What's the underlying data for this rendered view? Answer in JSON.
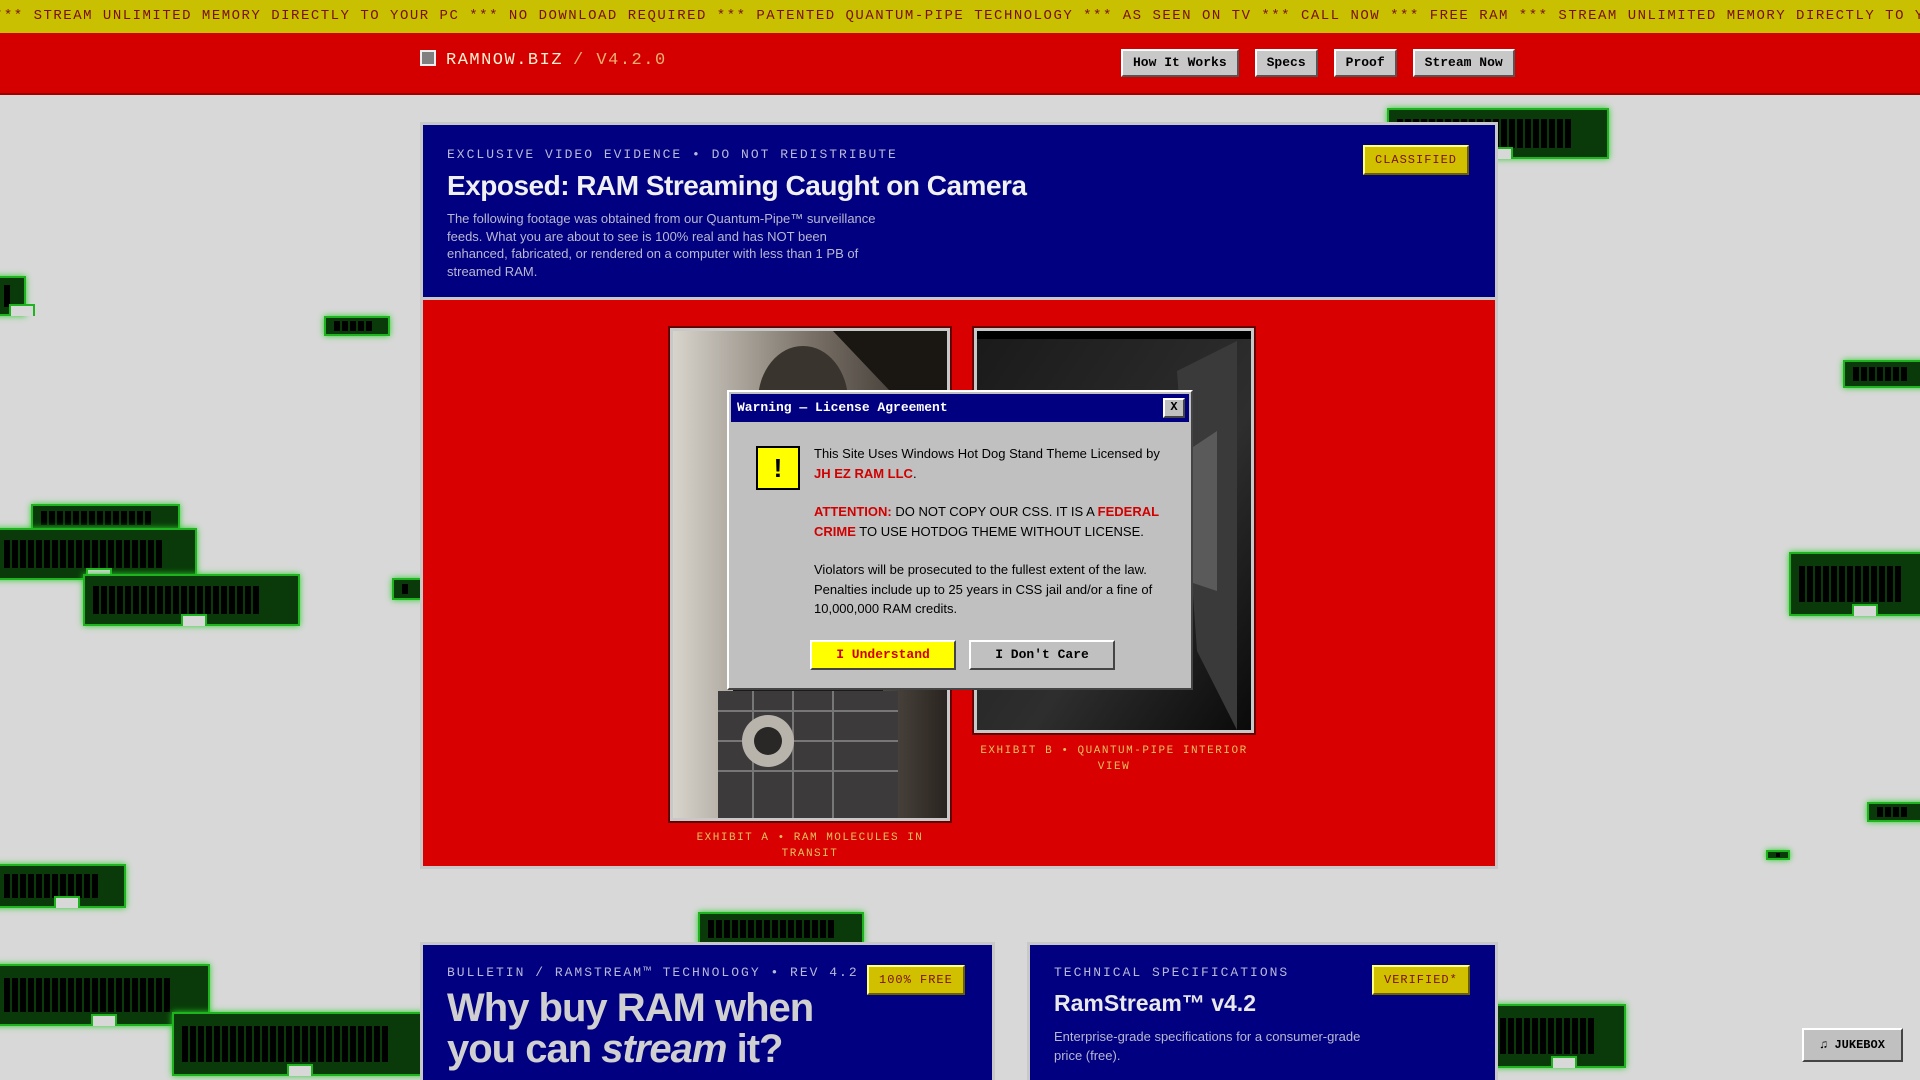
{
  "ticker": {
    "text": "*** STREAM UNLIMITED MEMORY DIRECTLY TO YOUR PC *** NO DOWNLOAD REQUIRED *** PATENTED QUANTUM-PIPE TECHNOLOGY *** AS SEEN ON TV *** CALL NOW *** FREE RAM *** STREAM UNLIMITED MEMORY DIRECTLY TO YOUR PC ***"
  },
  "header": {
    "brand": "RAMNOW.BIZ",
    "version": "/ V4.2.0",
    "nav": [
      "How It Works",
      "Specs",
      "Proof",
      "Stream Now"
    ]
  },
  "evidence": {
    "kicker": "EXCLUSIVE VIDEO EVIDENCE • DO NOT REDISTRIBUTE",
    "title": "Exposed: RAM Streaming Caught on Camera",
    "description": "The following footage was obtained from our Quantum-Pipe™ surveillance feeds. What you are about to see is 100% real and has NOT been enhanced, fabricated, or rendered on a computer with less than 1 PB of streamed RAM.",
    "badge": "CLASSIFIED",
    "exhibit_a": "EXHIBIT A • RAM MOLECULES IN TRANSIT",
    "exhibit_b_line1": "EXHIBIT B • QUANTUM-PIPE INTERIOR",
    "exhibit_b_line2": "VIEW"
  },
  "dialog": {
    "title": "Warning — License Agreement",
    "close": "X",
    "icon": "!",
    "p1_text": "This Site Uses Windows Hot Dog Stand Theme Licensed by",
    "p1_link": "JH EZ RAM LLC",
    "p2_attention": "ATTENTION:",
    "p2_mid": "DO NOT COPY OUR CSS. IT IS A",
    "p2_crime": "FEDERAL CRIME",
    "p2_end": "TO USE HOTDOG THEME WITHOUT LICENSE.",
    "p3": "Violators will be prosecuted to the fullest extent of the law. Penalties include up to 25 years in CSS jail and/or a fine of 10,000,000 RAM credits.",
    "btn_yes": "I Understand",
    "btn_no": "I Don't Care"
  },
  "bulletin": {
    "kicker": "BULLETIN / RAMSTREAM™ TECHNOLOGY • REV 4.2",
    "badge": "100% FREE",
    "title_line1": "Why buy RAM when",
    "title_line2_a": "you can",
    "title_line2_em": "stream",
    "title_line2_b": "it?"
  },
  "specs": {
    "kicker": "TECHNICAL SPECIFICATIONS",
    "badge": "VERIFIED*",
    "title": "RamStream™ v4.2",
    "description": "Enterprise-grade specifications for a consumer-grade price (free)."
  },
  "jukebox": {
    "icon": "♫",
    "label": "JUKEBOX"
  },
  "colors": {
    "ticker": "#c8c000",
    "header": "#d40000",
    "panel": "#000080",
    "accent": "#ffff00"
  }
}
